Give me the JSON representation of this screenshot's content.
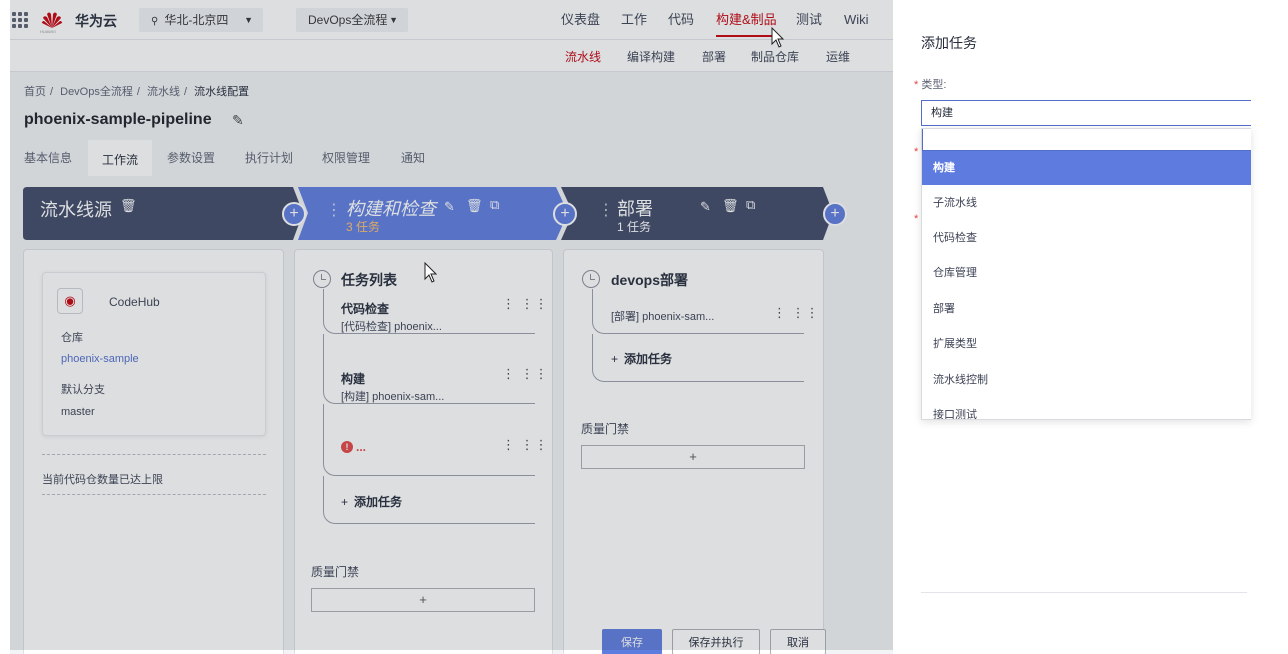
{
  "colors": {
    "accent": "#5e7ce0",
    "stage_dark": "#3f4866",
    "brand_red": "#c7000b"
  },
  "header": {
    "brand": "华为云",
    "logo_text": "HUAWEI",
    "region": "华北-北京四",
    "project": "DevOps全流程",
    "nav": [
      "仪表盘",
      "工作",
      "代码",
      "构建&制品",
      "测试",
      "Wiki"
    ],
    "active_nav": "构建&制品"
  },
  "subnav": [
    "流水线",
    "编译构建",
    "部署",
    "制品仓库",
    "运维"
  ],
  "breadcrumb": [
    "首页",
    "DevOps全流程",
    "流水线",
    "流水线配置"
  ],
  "breadcrumb_sep": "/",
  "page_title": "phoenix-sample-pipeline",
  "tabs": [
    "基本信息",
    "工作流",
    "参数设置",
    "执行计划",
    "权限管理",
    "通知"
  ],
  "active_tab": "工作流",
  "stages": [
    {
      "name": "流水线源",
      "sub": ""
    },
    {
      "name": "构建和检查",
      "sub": "3 任务"
    },
    {
      "name": "部署",
      "sub": "1 任务"
    }
  ],
  "source": {
    "repo_type": "CodeHub",
    "repo_label": "仓库",
    "repo_value": "phoenix-sample",
    "branch_label": "默认分支",
    "branch_value": "master",
    "limit_note": "当前代码仓数量已达上限"
  },
  "build_column": {
    "heading": "任务列表",
    "tasks": [
      {
        "name": "代码检查",
        "desc": "[代码检查] phoenix..."
      },
      {
        "name": "构建",
        "desc": "[构建] phoenix-sam..."
      },
      {
        "name": "...",
        "desc": ""
      }
    ],
    "add_task": "添加任务",
    "gate": "质量门禁",
    "gate_add": "+"
  },
  "deploy_column": {
    "heading": "devops部署",
    "tasks": [
      {
        "desc": "[部署] phoenix-sam..."
      }
    ],
    "add_task": "添加任务",
    "gate": "质量门禁",
    "gate_add": "+"
  },
  "footer_buttons": {
    "save": "保存",
    "save_run": "保存并执行",
    "cancel": "取消"
  },
  "panel": {
    "title": "添加任务",
    "type_label": "类型:",
    "type_value": "构建",
    "required_mark": "*",
    "options": [
      "构建",
      "子流水线",
      "代码检查",
      "仓库管理",
      "部署",
      "扩展类型",
      "流水线控制",
      "接口测试"
    ],
    "selected_option": "构建"
  },
  "icons": [
    "grid-icon",
    "huawei-logo-icon",
    "location-pin-icon",
    "chevron-down-icon",
    "pencil-icon",
    "trash-icon",
    "copy-icon",
    "drag-handle-icon",
    "plus-icon",
    "clock-icon",
    "more-icon",
    "error-icon",
    "codehub-icon"
  ]
}
